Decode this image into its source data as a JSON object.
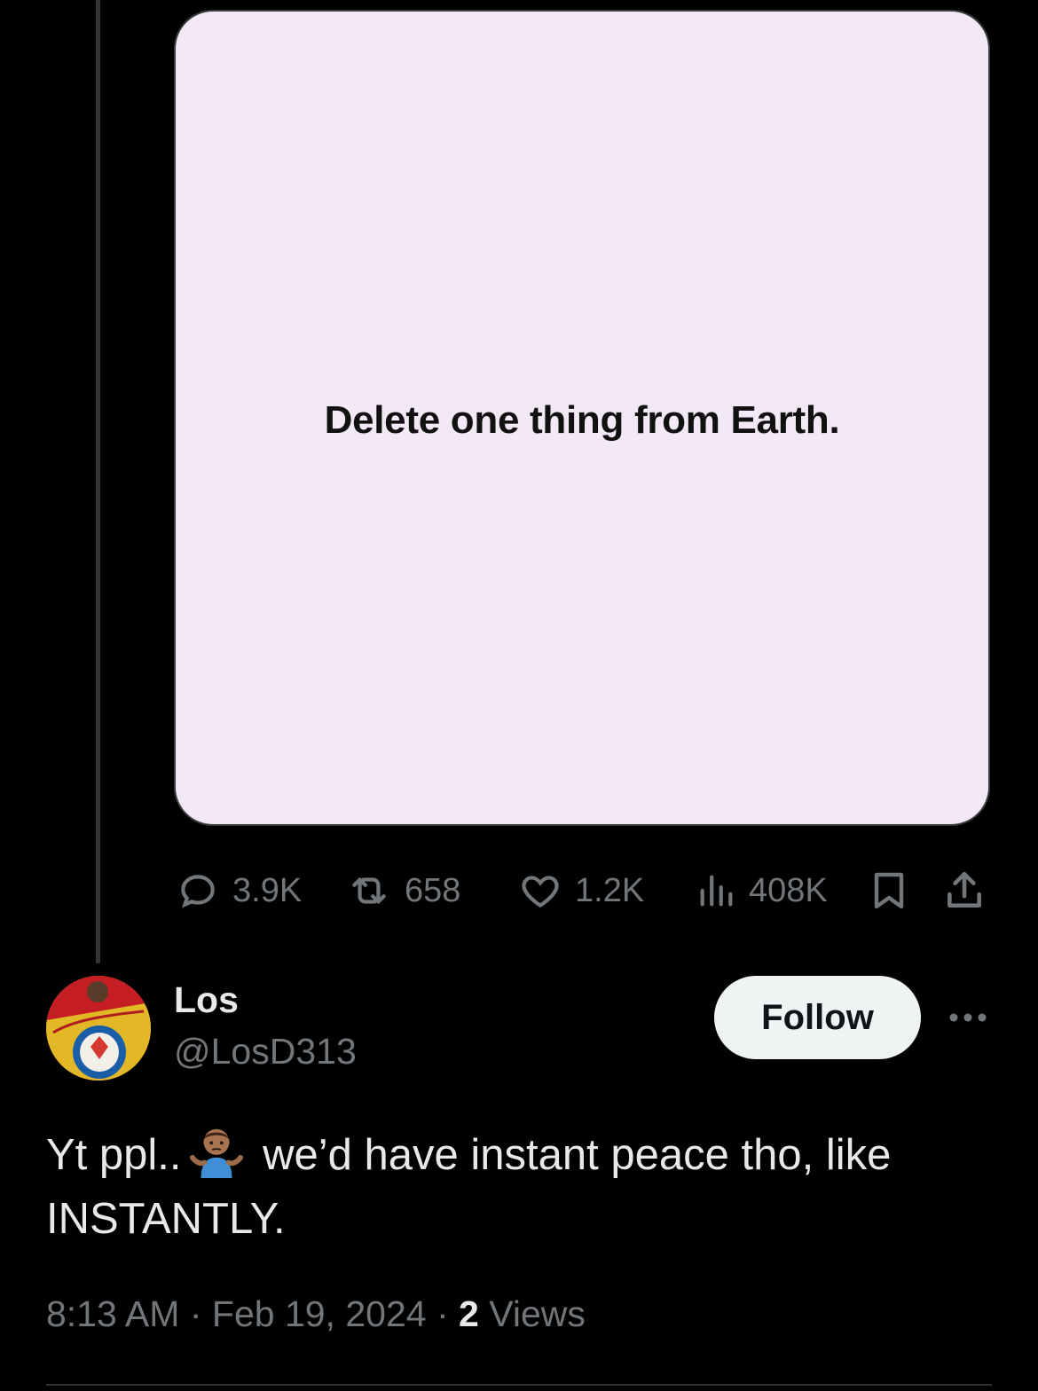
{
  "media": {
    "text": "Delete one thing from Earth.",
    "background": "#f3e8f5"
  },
  "actions": {
    "replies": "3.9K",
    "reposts": "658",
    "likes": "1.2K",
    "views": "408K",
    "icons": [
      "reply-icon",
      "repost-icon",
      "like-icon",
      "views-icon",
      "bookmark-icon",
      "share-icon"
    ]
  },
  "reply_tweet": {
    "author_name": "Los",
    "author_handle": "@LosD313",
    "follow_label": "Follow",
    "text_before_emoji": "Yt ppl..",
    "emoji": "man-shrugging",
    "text_after_emoji": " we’d have instant peace tho, like INSTANTLY.",
    "time": "8:13 AM",
    "date": "Feb 19, 2024",
    "views_count": "2",
    "views_label": "Views",
    "separator": "·"
  },
  "colors": {
    "background": "#000000",
    "text_primary": "#e7e9ea",
    "text_secondary": "#71767b",
    "follow_button_bg": "#eff3f4"
  }
}
